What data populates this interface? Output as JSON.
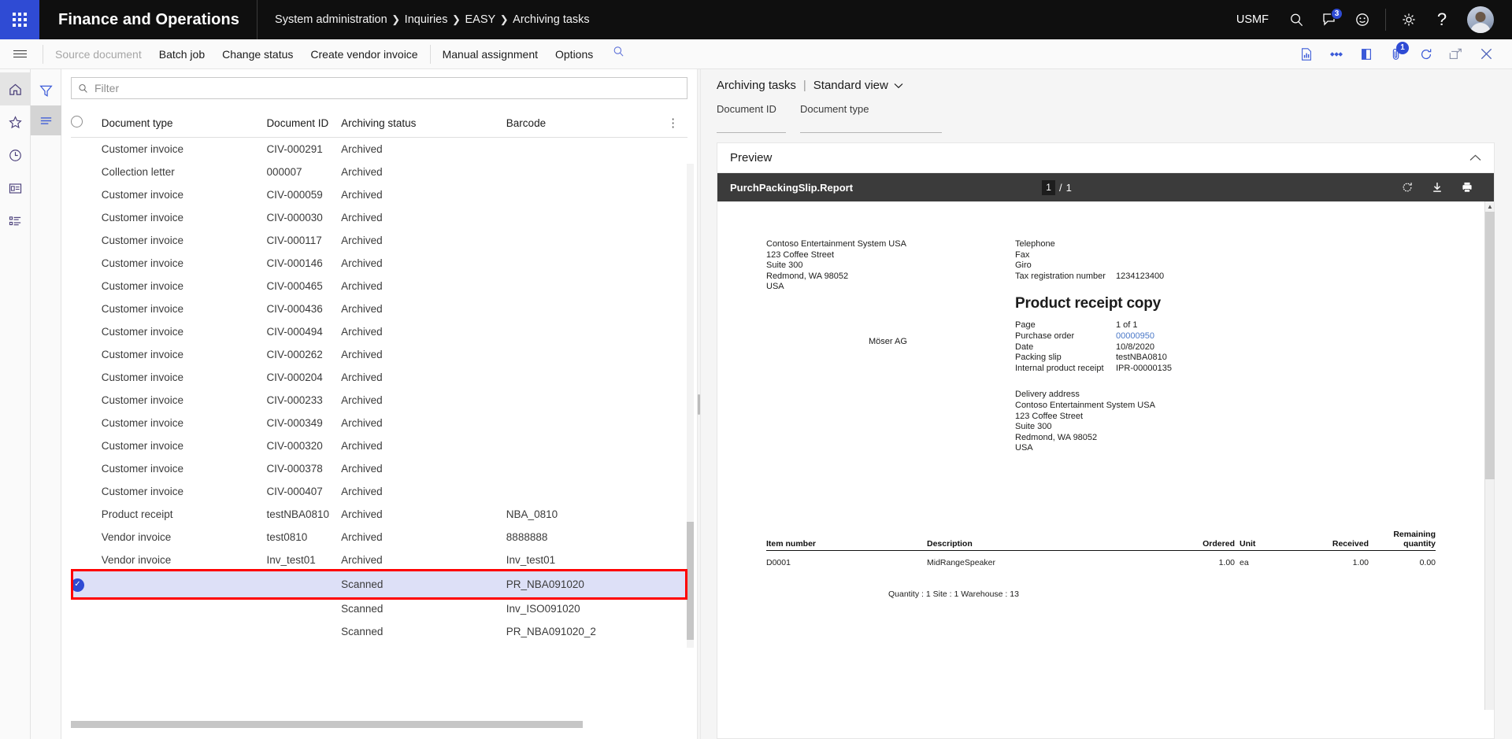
{
  "topnav": {
    "brand": "Finance and Operations",
    "breadcrumb": [
      "System administration",
      "Inquiries",
      "EASY",
      "Archiving tasks"
    ],
    "company": "USMF",
    "search_icon": "search-icon",
    "notifications_badge": "3",
    "feedback_icon": "smiley-icon",
    "settings_icon": "gear-icon",
    "help_icon": "question-mark-icon"
  },
  "actionpane": {
    "items": [
      {
        "label": "Source document",
        "disabled": true
      },
      {
        "label": "Batch job",
        "disabled": false
      },
      {
        "label": "Change status",
        "disabled": false
      },
      {
        "label": "Create vendor invoice",
        "disabled": false
      },
      {
        "label": "Manual assignment",
        "disabled": false
      },
      {
        "label": "Options",
        "disabled": false
      }
    ],
    "right_icons": [
      {
        "name": "report-icon",
        "badge": ""
      },
      {
        "name": "related-info-icon",
        "badge": ""
      },
      {
        "name": "page-options-icon",
        "badge": ""
      },
      {
        "name": "attachments-icon",
        "badge": "1"
      },
      {
        "name": "refresh-icon",
        "badge": ""
      },
      {
        "name": "open-in-new-window-icon",
        "badge": ""
      },
      {
        "name": "close-icon",
        "badge": ""
      }
    ]
  },
  "leftrail": {
    "items": [
      {
        "name": "home-icon",
        "active": true
      },
      {
        "name": "favorites-star-icon",
        "active": false
      },
      {
        "name": "recent-clock-icon",
        "active": false
      },
      {
        "name": "workspaces-icon",
        "active": false
      },
      {
        "name": "modules-list-icon",
        "active": false
      }
    ]
  },
  "filterrail": {
    "items": [
      {
        "name": "filter-funnel-icon",
        "active": false
      },
      {
        "name": "list-lines-icon",
        "active": true
      }
    ]
  },
  "grid": {
    "filter_placeholder": "Filter",
    "filter_value": "",
    "columns": [
      "Document type",
      "Document ID",
      "Archiving status",
      "Barcode"
    ],
    "rows": [
      {
        "type": "Customer invoice",
        "docid": "CIV-000291",
        "status": "Archived",
        "barcode": "",
        "selected": false
      },
      {
        "type": "Collection letter",
        "docid": "000007",
        "status": "Archived",
        "barcode": "",
        "selected": false
      },
      {
        "type": "Customer invoice",
        "docid": "CIV-000059",
        "status": "Archived",
        "barcode": "",
        "selected": false
      },
      {
        "type": "Customer invoice",
        "docid": "CIV-000030",
        "status": "Archived",
        "barcode": "",
        "selected": false
      },
      {
        "type": "Customer invoice",
        "docid": "CIV-000117",
        "status": "Archived",
        "barcode": "",
        "selected": false
      },
      {
        "type": "Customer invoice",
        "docid": "CIV-000146",
        "status": "Archived",
        "barcode": "",
        "selected": false
      },
      {
        "type": "Customer invoice",
        "docid": "CIV-000465",
        "status": "Archived",
        "barcode": "",
        "selected": false
      },
      {
        "type": "Customer invoice",
        "docid": "CIV-000436",
        "status": "Archived",
        "barcode": "",
        "selected": false
      },
      {
        "type": "Customer invoice",
        "docid": "CIV-000494",
        "status": "Archived",
        "barcode": "",
        "selected": false
      },
      {
        "type": "Customer invoice",
        "docid": "CIV-000262",
        "status": "Archived",
        "barcode": "",
        "selected": false
      },
      {
        "type": "Customer invoice",
        "docid": "CIV-000204",
        "status": "Archived",
        "barcode": "",
        "selected": false
      },
      {
        "type": "Customer invoice",
        "docid": "CIV-000233",
        "status": "Archived",
        "barcode": "",
        "selected": false
      },
      {
        "type": "Customer invoice",
        "docid": "CIV-000349",
        "status": "Archived",
        "barcode": "",
        "selected": false
      },
      {
        "type": "Customer invoice",
        "docid": "CIV-000320",
        "status": "Archived",
        "barcode": "",
        "selected": false
      },
      {
        "type": "Customer invoice",
        "docid": "CIV-000378",
        "status": "Archived",
        "barcode": "",
        "selected": false
      },
      {
        "type": "Customer invoice",
        "docid": "CIV-000407",
        "status": "Archived",
        "barcode": "",
        "selected": false
      },
      {
        "type": "Product receipt",
        "docid": "testNBA0810",
        "status": "Archived",
        "barcode": "NBA_0810",
        "selected": false
      },
      {
        "type": "Vendor invoice",
        "docid": "test0810",
        "status": "Archived",
        "barcode": "8888888",
        "selected": false
      },
      {
        "type": "Vendor invoice",
        "docid": "Inv_test01",
        "status": "Archived",
        "barcode": "Inv_test01",
        "selected": false
      },
      {
        "type": "",
        "docid": "",
        "status": "Scanned",
        "barcode": "PR_NBA091020",
        "selected": true
      },
      {
        "type": "",
        "docid": "",
        "status": "Scanned",
        "barcode": "Inv_ISO091020",
        "selected": false
      },
      {
        "type": "",
        "docid": "",
        "status": "Scanned",
        "barcode": "PR_NBA091020_2",
        "selected": false
      }
    ]
  },
  "detail": {
    "title": "Archiving tasks",
    "view_name": "Standard view",
    "fields": [
      {
        "label": "Document ID",
        "value": ""
      },
      {
        "label": "Document type",
        "value": ""
      }
    ],
    "preview": {
      "title": "Preview",
      "collapse_icon": "chevron-up-icon",
      "viewer": {
        "report_name": "PurchPackingSlip.Report",
        "current_page": "1",
        "page_separator": "/",
        "total_pages": "1",
        "icons": [
          {
            "name": "refresh-icon"
          },
          {
            "name": "download-icon"
          },
          {
            "name": "print-icon"
          }
        ]
      },
      "document": {
        "company_address": [
          "Contoso Entertainment System USA",
          "123 Coffee Street",
          "Suite 300",
          "Redmond, WA 98052",
          "USA"
        ],
        "contact_rows": [
          {
            "label": "Telephone",
            "value": ""
          },
          {
            "label": "Fax",
            "value": ""
          },
          {
            "label": "Giro",
            "value": ""
          },
          {
            "label": "Tax registration number",
            "value": "1234123400"
          }
        ],
        "heading": "Product receipt copy",
        "meta_rows": [
          {
            "label": "Page",
            "value": "1 of 1",
            "link": false
          },
          {
            "label": "Purchase order",
            "value": "00000950",
            "link": true
          },
          {
            "label": "Date",
            "value": "10/8/2020",
            "link": false
          },
          {
            "label": "Packing slip",
            "value": "testNBA0810",
            "link": false
          },
          {
            "label": "Internal product receipt",
            "value": "IPR-00000135",
            "link": false
          }
        ],
        "vendor_name": "Möser AG",
        "delivery_address": [
          "Delivery address",
          "Contoso Entertainment System USA",
          "123 Coffee Street",
          "Suite 300",
          "Redmond, WA 98052",
          "USA"
        ],
        "line_table": {
          "headers": [
            "Item number",
            "Description",
            "Ordered",
            "Unit",
            "Received",
            "Remaining quantity"
          ],
          "remaining_header_line1": "Remaining",
          "remaining_header_line2": "quantity",
          "rows": [
            {
              "item_number": "D0001",
              "description": "MidRangeSpeaker",
              "ordered": "1.00",
              "unit": "ea",
              "received": "1.00",
              "remaining": "0.00"
            }
          ],
          "note": "Quantity : 1  Site : 1   Warehouse : 13"
        }
      }
    }
  },
  "colors": {
    "accent": "#2f4bd4",
    "topnav_bg": "#0f0f0f",
    "selection_bg": "#dde0f7",
    "highlight_border": "#ff0000"
  }
}
